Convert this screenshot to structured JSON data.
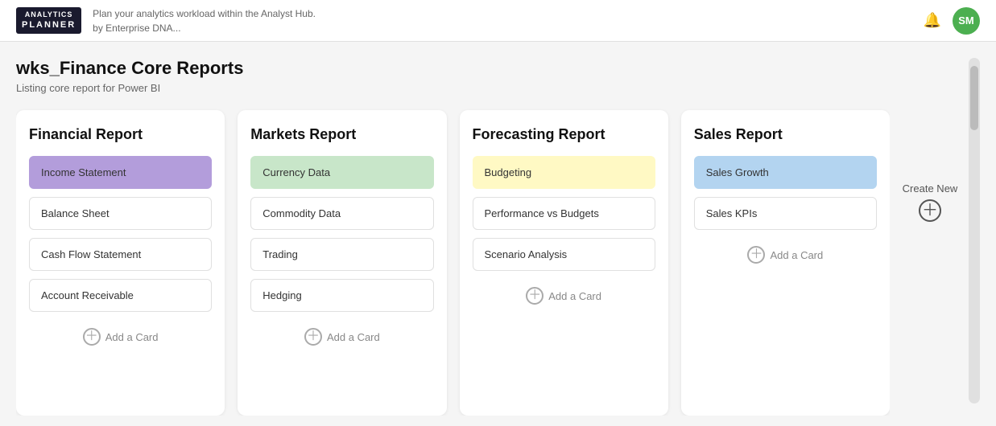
{
  "header": {
    "logo_line1": "ANALYTICS",
    "logo_line2": "PLANNER",
    "subtitle_line1": "Plan your analytics workload within the Analyst Hub.",
    "subtitle_line2": "by Enterprise DNA...",
    "avatar_initials": "SM"
  },
  "page": {
    "title": "wks_Finance Core Reports",
    "subtitle": "Listing core report for Power BI"
  },
  "create_new": {
    "label": "Create New"
  },
  "reports": [
    {
      "id": "financial",
      "title": "Financial Report",
      "items": [
        {
          "label": "Income Statement",
          "highlight": "highlighted-purple"
        },
        {
          "label": "Balance Sheet",
          "highlight": ""
        },
        {
          "label": "Cash Flow Statement",
          "highlight": ""
        },
        {
          "label": "Account Receivable",
          "highlight": ""
        }
      ],
      "add_card_label": "Add a Card"
    },
    {
      "id": "markets",
      "title": "Markets Report",
      "items": [
        {
          "label": "Currency Data",
          "highlight": "highlighted-green"
        },
        {
          "label": "Commodity Data",
          "highlight": ""
        },
        {
          "label": "Trading",
          "highlight": ""
        },
        {
          "label": "Hedging",
          "highlight": ""
        }
      ],
      "add_card_label": "Add a Card"
    },
    {
      "id": "forecasting",
      "title": "Forecasting Report",
      "items": [
        {
          "label": "Budgeting",
          "highlight": "highlighted-yellow"
        },
        {
          "label": "Performance vs Budgets",
          "highlight": ""
        },
        {
          "label": "Scenario Analysis",
          "highlight": ""
        }
      ],
      "add_card_label": "Add a Card"
    },
    {
      "id": "sales",
      "title": "Sales Report",
      "items": [
        {
          "label": "Sales Growth",
          "highlight": "highlighted-blue"
        },
        {
          "label": "Sales KPIs",
          "highlight": ""
        }
      ],
      "add_card_label": "Add a Card"
    }
  ]
}
